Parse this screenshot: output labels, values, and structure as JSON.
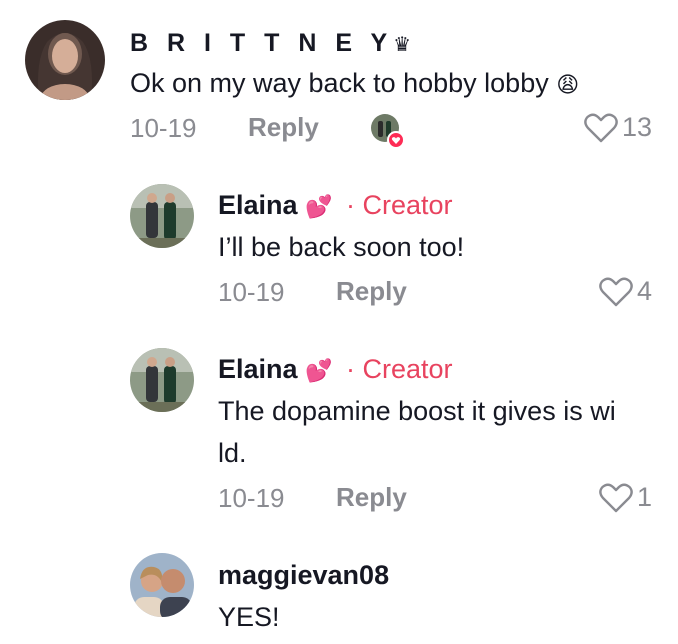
{
  "comments": [
    {
      "username": "B R I T T N E Y",
      "badge": "♛",
      "text": "Ok on my way back to hobby lobby",
      "emoji": "😩",
      "date": "10-19",
      "reply_label": "Reply",
      "likes": "13"
    },
    {
      "username": "Elaina",
      "emoji": "💕",
      "creator_label": "· Creator",
      "text": "I’ll be back soon too!",
      "date": "10-19",
      "reply_label": "Reply",
      "likes": "4"
    },
    {
      "username": "Elaina",
      "emoji": "💕",
      "creator_label": "· Creator",
      "text_line1": "The dopamine boost it gives is wi",
      "text_line2": "ld.",
      "date": "10-19",
      "reply_label": "Reply",
      "likes": "1"
    },
    {
      "username": "maggievan08",
      "text": "YES!"
    }
  ],
  "colors": {
    "creator": "#e8435f",
    "secondary_text": "#8a8b91",
    "heart_badge": "#fe2c55"
  }
}
